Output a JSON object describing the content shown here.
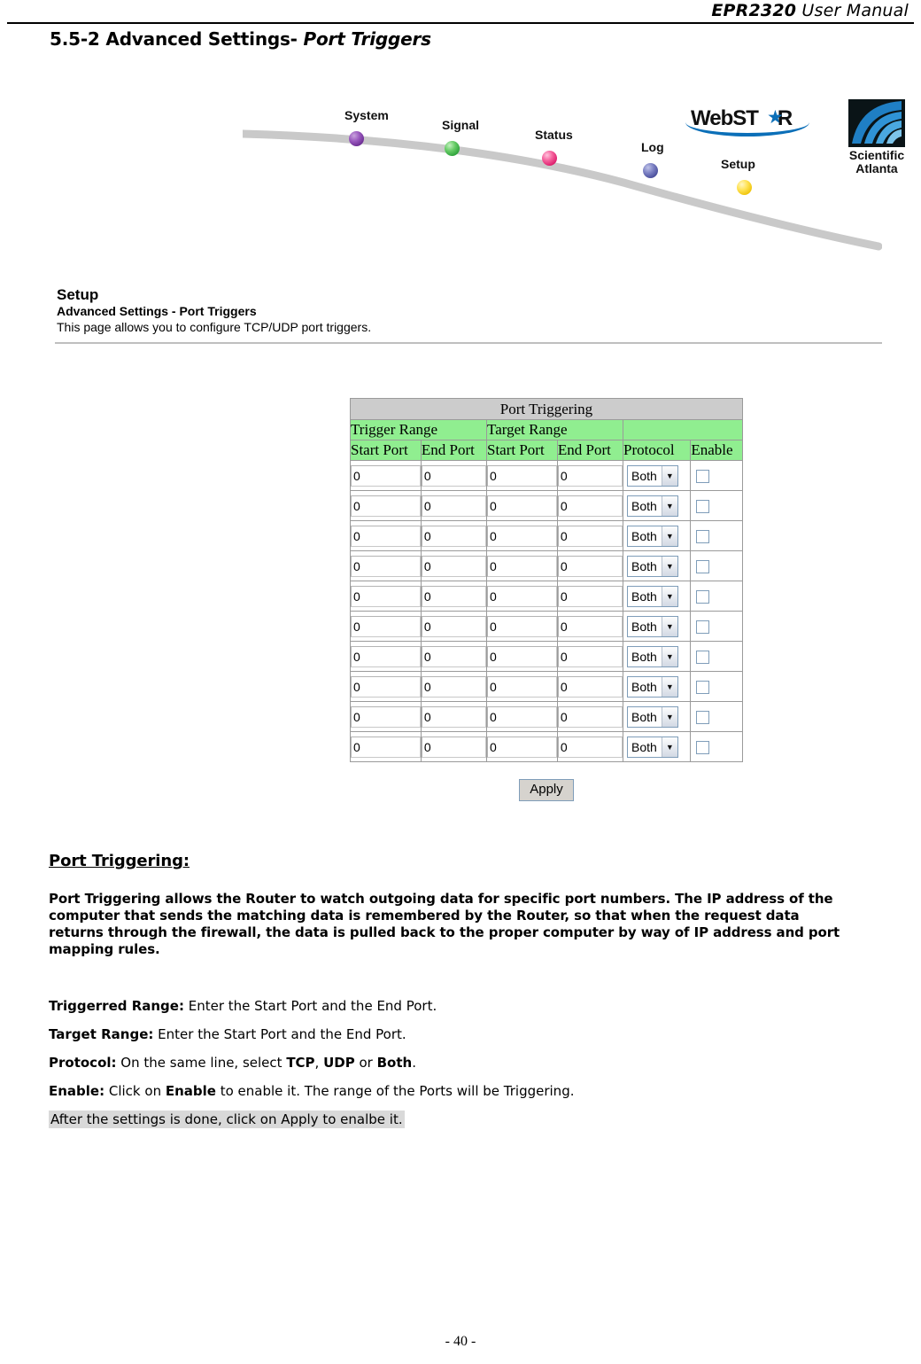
{
  "header": {
    "model": "EPR2320",
    "manual": " User Manual"
  },
  "section": {
    "number_title": "5.5-2 Advanced Settings-",
    "subject": " Port Triggers"
  },
  "nav_banner": {
    "items": [
      {
        "label": "System",
        "color": "#7d3f98"
      },
      {
        "label": "Signal",
        "color": "#3cb54a"
      },
      {
        "label": "Status",
        "color": "#ec2d78"
      },
      {
        "label": "Log",
        "color": "#5b5ea6"
      },
      {
        "label": "Setup",
        "color": "#f5d020"
      }
    ],
    "brand": {
      "webstar": "WebST",
      "webstar_tail": "R",
      "star_glyph": "★",
      "company_line1": "Scientific",
      "company_line2": "Atlanta"
    }
  },
  "setup_panel": {
    "title": "Setup",
    "subtitle": "Advanced Settings - Port Triggers",
    "description": "This page allows you to configure TCP/UDP port triggers."
  },
  "port_table": {
    "caption": "Port Triggering",
    "group_headers": [
      "Trigger Range",
      "Target Range",
      ""
    ],
    "column_headers": [
      "Start Port",
      "End Port",
      "Start Port",
      "End Port",
      "Protocol",
      "Enable"
    ],
    "protocol_options": [
      "TCP",
      "UDP",
      "Both"
    ],
    "row_count": 10,
    "default_port_value": "0",
    "default_protocol": "Both",
    "default_enabled": false,
    "apply_label": "Apply",
    "colors": {
      "caption_bg": "#cccccc",
      "header_bg": "#90ee90",
      "border": "#9a9a9a"
    }
  },
  "body": {
    "heading": "Port Triggering:",
    "paragraph": "Port Triggering allows the Router to watch outgoing data for specific port numbers. The IP address of the computer that sends the matching data is remembered by the Router, so that when the request data returns through the firewall, the data is pulled back to the proper computer by way of IP address and port mapping rules.",
    "definitions": [
      {
        "term": "Triggerred Range:",
        "text": " Enter the Start Port and the End Port."
      },
      {
        "term": "Target Range:",
        "text": " Enter the Start Port and the End Port."
      },
      {
        "term": "Protocol:",
        "text": "   On the same line, select ",
        "emph1": "TCP",
        "mid1": ", ",
        "emph2": "UDP",
        "mid2": " or ",
        "emph3": "Both",
        "tail": "."
      },
      {
        "term": "Enable:",
        "text": " Click on ",
        "emph1": "Enable",
        "tail": " to enable it. The range of the Ports will be Triggering."
      }
    ],
    "note": "After the settings is done, click on Apply to enalbe it."
  },
  "footer": {
    "page_number": "- 40 -"
  }
}
